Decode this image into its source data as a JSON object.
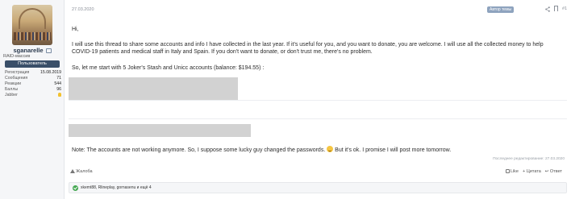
{
  "user": {
    "username": "sganarelle",
    "title": "RAID-массив",
    "role": "Пользователь",
    "stats": [
      {
        "label": "Регистрация",
        "value": "15.08.2019"
      },
      {
        "label": "Сообщения",
        "value": "71"
      },
      {
        "label": "Реакции",
        "value": "544"
      },
      {
        "label": "Баллы",
        "value": "96"
      },
      {
        "label": "Jabber",
        "value": ""
      }
    ]
  },
  "post": {
    "date": "27.03.2020",
    "author_badge": "Автор темы",
    "number": "#1",
    "greeting": "Hi,",
    "paragraph": "I will use this thread to share some accounts and info I have collected in the last year. If it's useful for you, and you want to donate, you are welcome. I will use all the collected money to help COVID-19 patients and medical staff in Italy and Spain. If you don't want to donate, or don't trust me, there's no problem.",
    "intro": "So, let me start with 5 Joker's Stash and Unicc accounts (balance: $194.55) :",
    "note_before": "Note: The accounts are not working anymore. So, I suppose some lucky guy changed the passwords.",
    "note_after": "But it's ok. I promise I will post more tomorrow.",
    "edited": "Последнее редактирование: 27.03.2020"
  },
  "actions": {
    "report": "Жалоба",
    "like": "Like",
    "quote": "+ Цитата",
    "reply": "↩ Ответ"
  },
  "reactions": {
    "text": "xkemt88, Rlineplay, gornasenu и ещё 4"
  },
  "colors": {
    "role_badge": "#3a4f69",
    "author_badge": "#8ea3be",
    "reaction": "#46a852"
  }
}
